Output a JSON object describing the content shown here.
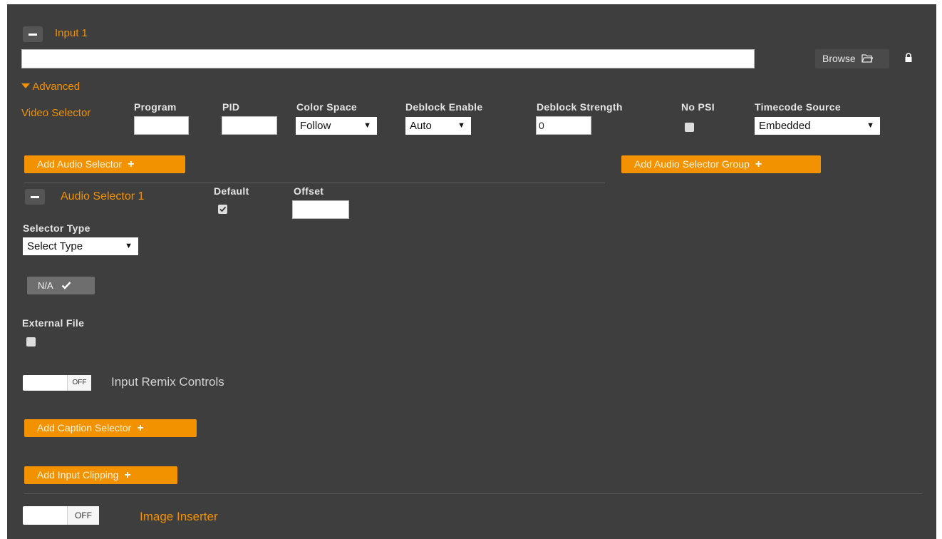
{
  "input": {
    "title": "Input 1",
    "file_value": "",
    "browse_label": "Browse",
    "browse_icon": "folder-icon",
    "lock_icon": "lock-icon"
  },
  "advanced": {
    "label": "Advanced",
    "video_selector": {
      "label": "Video Selector",
      "program_label": "Program",
      "program_value": "",
      "pid_label": "PID",
      "pid_value": "",
      "color_space_label": "Color Space",
      "color_space_value": "Follow",
      "deblock_enable_label": "Deblock Enable",
      "deblock_enable_value": "Auto",
      "deblock_strength_label": "Deblock Strength",
      "deblock_strength_value": "0",
      "no_psi_label": "No PSI",
      "timecode_source_label": "Timecode Source",
      "timecode_source_value": "Embedded"
    }
  },
  "audio": {
    "add_selector_label": "Add Audio Selector",
    "add_group_label": "Add Audio Selector Group",
    "selector_title": "Audio Selector 1",
    "default_label": "Default",
    "default_checked": true,
    "offset_label": "Offset",
    "offset_value": "",
    "selector_type_label": "Selector Type",
    "selector_type_value": "Select Type",
    "na_label": "N/A",
    "external_file_label": "External File",
    "remix_toggle_label": "OFF",
    "remix_label": "Input Remix Controls"
  },
  "caption": {
    "add_label": "Add Caption Selector"
  },
  "clipping": {
    "add_label": "Add Input Clipping"
  },
  "image_inserter": {
    "toggle_label": "OFF",
    "label": "Image Inserter"
  },
  "colors": {
    "accent": "#f39200",
    "panel_bg": "#3e3e3e",
    "page_bg": "#ffffff"
  }
}
